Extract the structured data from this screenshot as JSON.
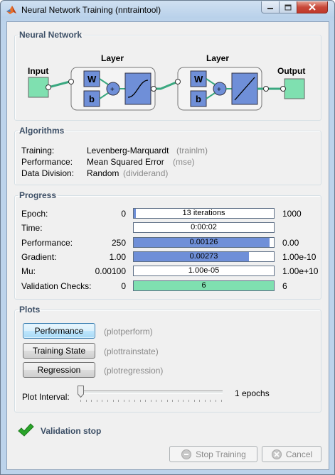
{
  "window": {
    "title": "Neural Network Training (nntraintool)"
  },
  "network": {
    "legend": "Neural Network",
    "input_label": "Input",
    "output_label": "Output",
    "layers": [
      {
        "label": "Layer",
        "w": "W",
        "b": "b",
        "sum": "+"
      },
      {
        "label": "Layer",
        "w": "W",
        "b": "b",
        "sum": "+"
      }
    ]
  },
  "algorithms": {
    "legend": "Algorithms",
    "rows": [
      {
        "label": "Training:",
        "value": "Levenberg-Marquardt",
        "fn": "(trainlm)"
      },
      {
        "label": "Performance:",
        "value": "Mean Squared Error",
        "fn": "(mse)"
      },
      {
        "label": "Data Division:",
        "value": "Random",
        "fn": "(dividerand)"
      }
    ]
  },
  "progress": {
    "legend": "Progress",
    "rows": [
      {
        "label": "Epoch:",
        "start": "0",
        "current": "13 iterations",
        "end": "1000",
        "fill": 0.013,
        "color": "#6f8fd8"
      },
      {
        "label": "Time:",
        "start": "",
        "current": "0:00:02",
        "end": "",
        "fill": 0,
        "color": "#6f8fd8"
      },
      {
        "label": "Performance:",
        "start": "250",
        "current": "0.00126",
        "end": "0.00",
        "fill": 0.97,
        "color": "#6f8fd8"
      },
      {
        "label": "Gradient:",
        "start": "1.00",
        "current": "0.00273",
        "end": "1.00e-10",
        "fill": 0.82,
        "color": "#6f8fd8"
      },
      {
        "label": "Mu:",
        "start": "0.00100",
        "current": "1.00e-05",
        "end": "1.00e+10",
        "fill": 0,
        "color": "#6f8fd8"
      },
      {
        "label": "Validation Checks:",
        "start": "0",
        "current": "6",
        "end": "6",
        "fill": 1.0,
        "color": "#7fe0b0"
      }
    ]
  },
  "plots": {
    "legend": "Plots",
    "buttons": [
      {
        "label": "Performance",
        "fn": "(plotperform)"
      },
      {
        "label": "Training State",
        "fn": "(plottrainstate)"
      },
      {
        "label": "Regression",
        "fn": "(plotregression)"
      }
    ],
    "interval_label": "Plot Interval:",
    "interval_value": "1 epochs",
    "interval_level": 0
  },
  "status": {
    "text": "Validation stop",
    "icon": "checkmark-icon",
    "color": "#2aa52a"
  },
  "footer": {
    "stop_label": "Stop Training",
    "cancel_label": "Cancel"
  }
}
